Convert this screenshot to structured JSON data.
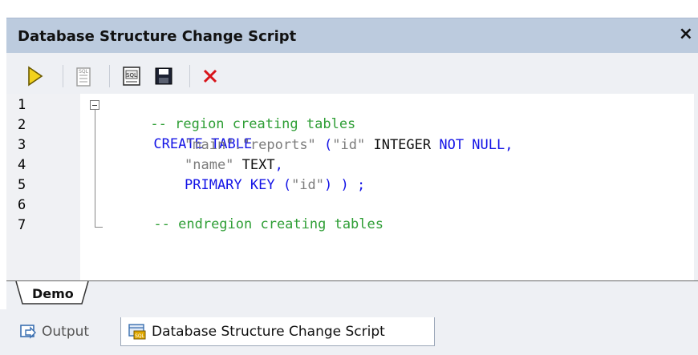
{
  "window": {
    "title": "Database Structure Change Script",
    "close_glyph": "×"
  },
  "toolbar": {
    "buttons": [
      {
        "name": "execute-button",
        "icon": "play-icon"
      },
      {
        "name": "open-sql-editor-button",
        "icon": "sql-document-icon"
      },
      {
        "name": "open-sql-file-button",
        "icon": "sql-file-icon"
      },
      {
        "name": "save-button",
        "icon": "floppy-disk-icon"
      },
      {
        "name": "close-script-button",
        "icon": "red-x-icon"
      }
    ]
  },
  "editor": {
    "line_numbers": [
      "1",
      "2",
      "3",
      "4",
      "5",
      "6",
      "7"
    ],
    "lines": {
      "l1": {
        "comment": "-- region creating tables"
      },
      "l2": {
        "keyword": "CREATE TABLE"
      },
      "l3": {
        "a": "\"main\"",
        "b": ".",
        "c": "\"reports\"",
        "d": " (",
        "e": "\"id\"",
        "f": " INTEGER ",
        "g": "NOT NULL,"
      },
      "l4": {
        "a": "\"name\"",
        "b": " TEXT",
        "c": ","
      },
      "l5": {
        "a": "PRIMARY KEY (",
        "b": "\"id\"",
        "c": ") ) ;"
      },
      "l6": {
        "comment": "-- endregion creating tables"
      }
    }
  },
  "tabs": {
    "demo": "Demo"
  },
  "bottom_tabs": {
    "output": "Output",
    "script": "Database Structure Change Script"
  },
  "colors": {
    "comment": "#2e9e35",
    "keyword": "#1414e6",
    "string": "#7c7c7c",
    "title_bar": "#bccbde"
  }
}
